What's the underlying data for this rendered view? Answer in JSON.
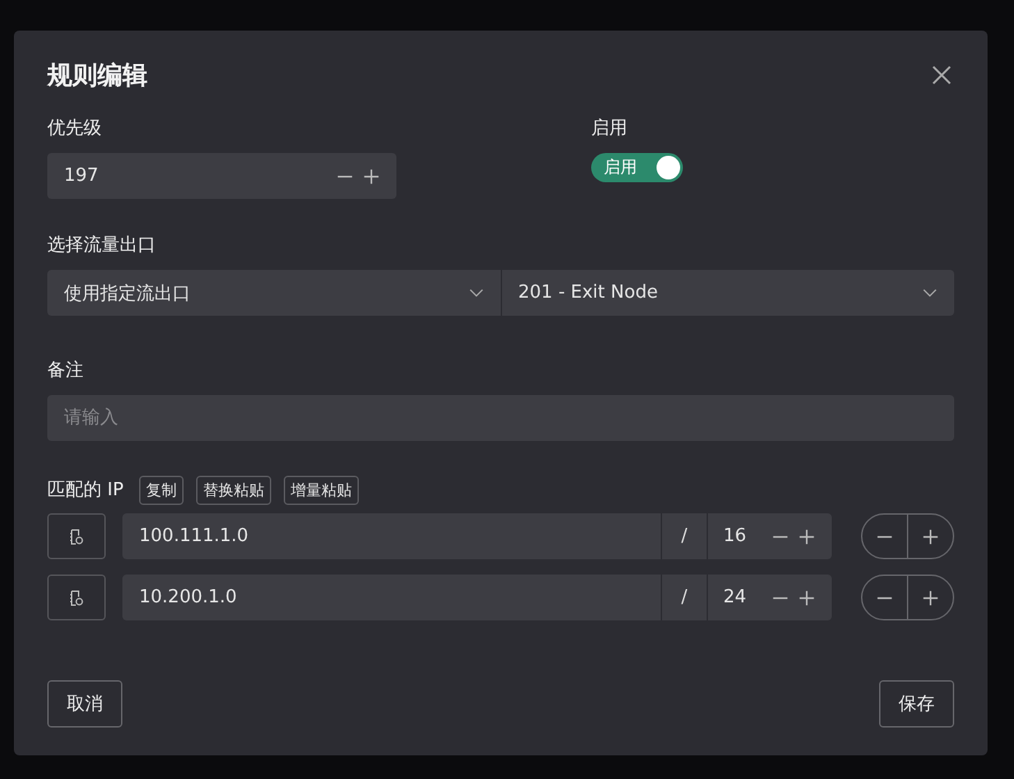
{
  "dialog": {
    "title": "规则编辑",
    "priority": {
      "label": "优先级",
      "value": "197"
    },
    "enabled": {
      "label": "启用",
      "toggle_text": "启用",
      "on": true
    },
    "exit": {
      "label": "选择流量出口",
      "mode": "使用指定流出口",
      "node": "201 - Exit Node"
    },
    "note": {
      "label": "备注",
      "placeholder": "请输入"
    },
    "match_ip": {
      "label": "匹配的 IP",
      "actions": [
        "复制",
        "替换粘贴",
        "增量粘贴"
      ],
      "rows": [
        {
          "ip": "100.111.1.0",
          "separator": "/",
          "prefix": "16"
        },
        {
          "ip": "10.200.1.0",
          "separator": "/",
          "prefix": "24"
        }
      ]
    },
    "buttons": {
      "cancel": "取消",
      "save": "保存"
    }
  }
}
